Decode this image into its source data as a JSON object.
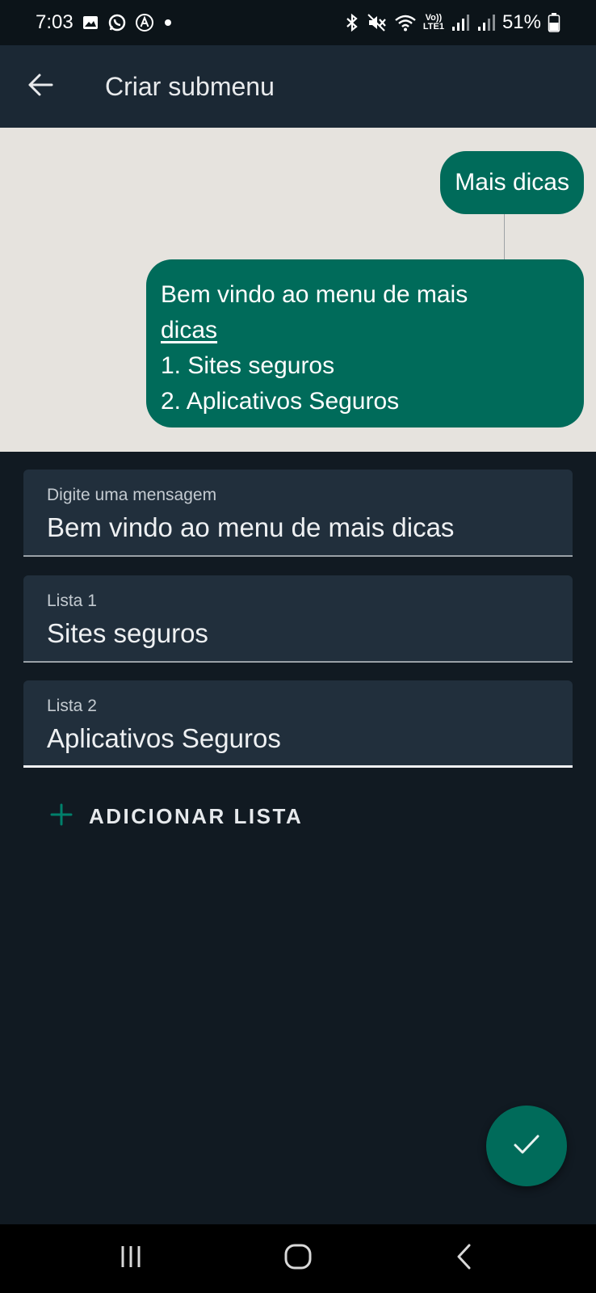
{
  "status_bar": {
    "time": "7:03",
    "battery": "51%",
    "left_icons": [
      "image-icon",
      "whatsapp-icon",
      "accessibility-a-icon",
      "dot-icon"
    ],
    "right_icons": [
      "bluetooth-icon",
      "mute-icon",
      "wifi-icon",
      "volte-icon",
      "signal-icon",
      "signal-icon",
      "battery-icon"
    ],
    "volte_label_top": "Vo))",
    "volte_label_bottom": "LTE1"
  },
  "app_bar": {
    "title": "Criar submenu"
  },
  "preview": {
    "button_bubble": "Mais dicas",
    "message_lines": [
      "Bem vindo ao menu de mais",
      "dicas",
      "1. Sites seguros",
      "2. Aplicativos Seguros"
    ]
  },
  "fields": [
    {
      "label": "Digite uma mensagem",
      "value": "Bem vindo ao menu de mais dicas"
    },
    {
      "label": "Lista 1",
      "value": "Sites seguros"
    },
    {
      "label": "Lista 2",
      "value": "Aplicativos Seguros"
    }
  ],
  "add_list": {
    "label": "ADICIONAR LISTA"
  },
  "colors": {
    "accent": "#006b5a",
    "background": "#111a22",
    "app_bar": "#1b2834",
    "field_background": "#212f3c",
    "preview_background": "#e6e3de"
  }
}
